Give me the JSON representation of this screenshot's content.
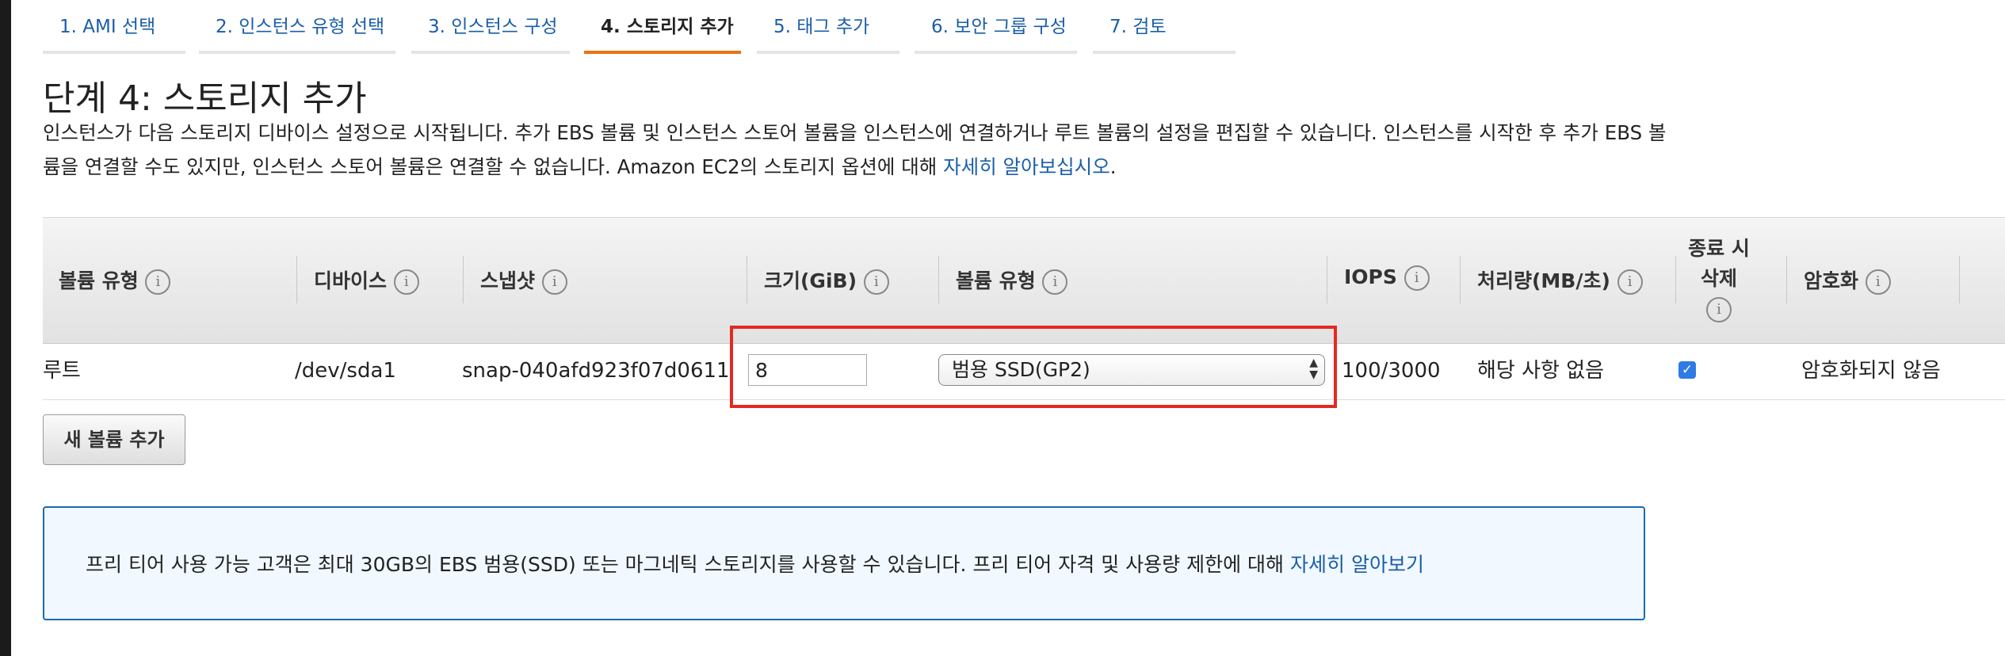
{
  "wizard_tabs": [
    {
      "label": "1. AMI 선택"
    },
    {
      "label": "2. 인스턴스 유형 선택"
    },
    {
      "label": "3. 인스턴스 구성"
    },
    {
      "label": "4. 스토리지 추가",
      "active": true
    },
    {
      "label": "5. 태그 추가"
    },
    {
      "label": "6. 보안 그룹 구성"
    },
    {
      "label": "7. 검토"
    }
  ],
  "page": {
    "title": "단계 4: 스토리지 추가",
    "description": "인스턴스가 다음 스토리지 디바이스 설정으로 시작됩니다. 추가 EBS 볼륨 및 인스턴스 스토어 볼륨을 인스턴스에 연결하거나 루트 볼륨의 설정을 편집할 수 있습니다. 인스턴스를 시작한 후 추가 EBS 볼륨을 연결할 수도 있지만, 인스턴스 스토어 볼륨은 연결할 수 없습니다. Amazon EC2의 스토리지 옵션에 대해 ",
    "learn_more_link": "자세히 알아보십시오",
    "description_end": "."
  },
  "table": {
    "headers": {
      "volume_kind": "볼륨 유형",
      "device": "디바이스",
      "snapshot": "스냅샷",
      "size": "크기(GiB)",
      "volume_type": "볼륨 유형",
      "iops": "IOPS",
      "throughput": "처리량(MB/초)",
      "delete_on_term_line1": "종료 시",
      "delete_on_term_line2": "삭제",
      "encryption": "암호화"
    },
    "info_glyph": "i",
    "row": {
      "volume_kind": "루트",
      "device": "/dev/sda1",
      "snapshot": "snap-040afd923f07d0611",
      "size": "8",
      "volume_type": "범용 SSD(GP2)",
      "iops": "100/3000",
      "throughput": "해당 사항 없음",
      "delete_on_termination": true,
      "encryption": "암호화되지 않음"
    }
  },
  "add_volume_button": "새 볼륨 추가",
  "notice": {
    "text": "프리 티어 사용 가능 고객은 최대 30GB의 EBS 범용(SSD) 또는 마그네틱 스토리지를 사용할 수 있습니다. 프리 티어 자격 및 사용량 제한에 대해 ",
    "link": "자세히 알아보기"
  },
  "colors": {
    "accent_tab": "#ec7211",
    "link": "#1a5ea8",
    "highlight": "#e32a20",
    "notice_border": "#1a6ab0",
    "checkbox": "#2f7ae5"
  },
  "icons": {
    "info": "info-circle-icon",
    "select_arrows": "select-updown-arrows-icon",
    "checkbox": "checkmark-icon"
  }
}
